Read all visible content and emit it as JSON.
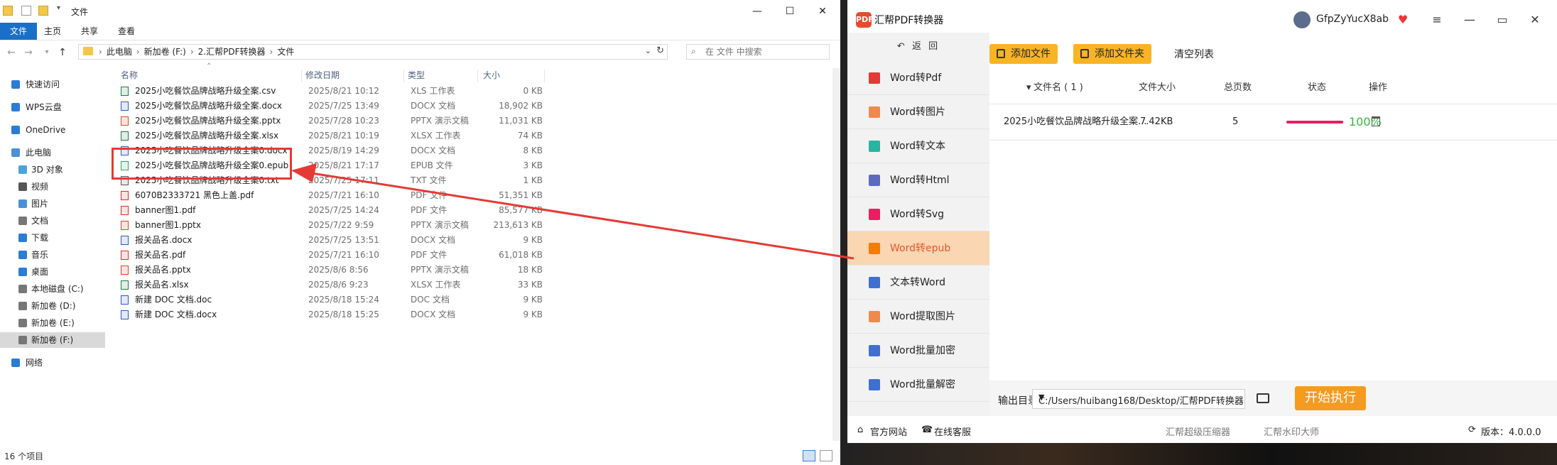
{
  "explorer": {
    "title": "文件",
    "ribbon_tabs": [
      "文件",
      "主页",
      "共享",
      "查看"
    ],
    "breadcrumbs": [
      "此电脑",
      "新加卷 (F:)",
      "2.汇帮PDF转换器",
      "文件"
    ],
    "search_placeholder": "在 文件 中搜索",
    "nav": [
      {
        "label": "快速访问",
        "icon": "star-icon",
        "color": "#2b7cd3"
      },
      {
        "label": "WPS云盘",
        "icon": "cloud-icon",
        "color": "#2b7cd3"
      },
      {
        "label": "OneDrive",
        "icon": "cloud-icon",
        "color": "#2b7cd3"
      },
      {
        "label": "此电脑",
        "icon": "computer-icon",
        "color": "#4a90d9"
      },
      {
        "label": "3D 对象",
        "icon": "cube-icon",
        "color": "#4aa3df"
      },
      {
        "label": "视频",
        "icon": "video-icon",
        "color": "#555555"
      },
      {
        "label": "图片",
        "icon": "picture-icon",
        "color": "#4a90d9"
      },
      {
        "label": "文档",
        "icon": "document-icon",
        "color": "#777777"
      },
      {
        "label": "下载",
        "icon": "download-icon",
        "color": "#2b7cd3"
      },
      {
        "label": "音乐",
        "icon": "music-icon",
        "color": "#2b7cd3"
      },
      {
        "label": "桌面",
        "icon": "desktop-icon",
        "color": "#2b7cd3"
      },
      {
        "label": "本地磁盘 (C:)",
        "icon": "drive-icon",
        "color": "#777777"
      },
      {
        "label": "新加卷 (D:)",
        "icon": "drive-icon",
        "color": "#777777"
      },
      {
        "label": "新加卷 (E:)",
        "icon": "drive-icon",
        "color": "#777777"
      },
      {
        "label": "新加卷 (F:)",
        "icon": "drive-icon",
        "color": "#777777"
      },
      {
        "label": "网络",
        "icon": "network-icon",
        "color": "#2b7cd3"
      }
    ],
    "columns": [
      "名称",
      "修改日期",
      "类型",
      "大小"
    ],
    "files": [
      {
        "name": "2025小吃餐饮品牌战略升级全案.csv",
        "date": "2025/8/21 10:12",
        "type": "XLS 工作表",
        "size": "0 KB",
        "color": "#1d7a45"
      },
      {
        "name": "2025小吃餐饮品牌战略升级全案.docx",
        "date": "2025/7/25 13:49",
        "type": "DOCX 文档",
        "size": "18,902 KB",
        "color": "#2b5cb8"
      },
      {
        "name": "2025小吃餐饮品牌战略升级全案.pptx",
        "date": "2025/7/28 10:23",
        "type": "PPTX 演示文稿",
        "size": "11,031 KB",
        "color": "#d24726"
      },
      {
        "name": "2025小吃餐饮品牌战略升级全案.xlsx",
        "date": "2025/8/21 10:19",
        "type": "XLSX 工作表",
        "size": "74 KB",
        "color": "#1d7a45"
      },
      {
        "name": "2025小吃餐饮品牌战略升级全案0.docx",
        "date": "2025/8/19 14:29",
        "type": "DOCX 文档",
        "size": "8 KB",
        "color": "#2b5cb8"
      },
      {
        "name": "2025小吃餐饮品牌战略升级全案0.epub",
        "date": "2025/8/21 17:17",
        "type": "EPUB 文件",
        "size": "3 KB",
        "color": "#3a9c6a"
      },
      {
        "name": "2025小吃餐饮品牌战略升级全案0.txt",
        "date": "2025/7/25 17:11",
        "type": "TXT 文件",
        "size": "1 KB",
        "color": "#555555"
      },
      {
        "name": "6070B2333721 黑色上盖.pdf",
        "date": "2025/7/21 16:10",
        "type": "PDF 文件",
        "size": "51,351 KB",
        "color": "#d93025"
      },
      {
        "name": "banner图1.pdf",
        "date": "2025/7/25 14:24",
        "type": "PDF 文件",
        "size": "85,577 KB",
        "color": "#d93025"
      },
      {
        "name": "banner图1.pptx",
        "date": "2025/7/22 9:59",
        "type": "PPTX 演示文稿",
        "size": "213,613 KB",
        "color": "#d24726"
      },
      {
        "name": "报关品名.docx",
        "date": "2025/7/25 13:51",
        "type": "DOCX 文档",
        "size": "9 KB",
        "color": "#2b5cb8"
      },
      {
        "name": "报关品名.pdf",
        "date": "2025/7/21 16:10",
        "type": "PDF 文件",
        "size": "61,018 KB",
        "color": "#d93025"
      },
      {
        "name": "报关品名.pptx",
        "date": "2025/8/6 8:56",
        "type": "PPTX 演示文稿",
        "size": "18 KB",
        "color": "#d24726"
      },
      {
        "name": "报关品名.xlsx",
        "date": "2025/8/6 9:23",
        "type": "XLSX 工作表",
        "size": "33 KB",
        "color": "#1d7a45"
      },
      {
        "name": "新建 DOC 文档.doc",
        "date": "2025/8/18 15:24",
        "type": "DOC 文档",
        "size": "9 KB",
        "color": "#2b5cb8"
      },
      {
        "name": "新建 DOC 文档.docx",
        "date": "2025/8/18 15:25",
        "type": "DOCX 文档",
        "size": "9 KB",
        "color": "#2b5cb8"
      }
    ],
    "status": "16 个项目"
  },
  "app": {
    "logo_text": "PDF",
    "title": "汇帮PDF转换器",
    "user": "GfpZyYucX8ab",
    "back_label": "返 回",
    "menu": [
      {
        "label": "Word转Pdf",
        "color": "#e53935"
      },
      {
        "label": "Word转图片",
        "color": "#f08a4b"
      },
      {
        "label": "Word转文本",
        "color": "#26b5a0"
      },
      {
        "label": "Word转Html",
        "color": "#5c6bc0"
      },
      {
        "label": "Word转Svg",
        "color": "#e91e63"
      },
      {
        "label": "Word转epub",
        "color": "#f57c00"
      },
      {
        "label": "文本转Word",
        "color": "#3f6fd1"
      },
      {
        "label": "Word提取图片",
        "color": "#f08a4b"
      },
      {
        "label": "Word批量加密",
        "color": "#3f6fd1"
      },
      {
        "label": "Word批量解密",
        "color": "#3f6fd1"
      }
    ],
    "active_index": 5,
    "add_file": "添加文件",
    "add_folder": "添加文件夹",
    "clear_list": "清空列表",
    "table_headers": [
      "文件名 ( 1 )",
      "文件大小",
      "总页数",
      "状态",
      "操作"
    ],
    "row": {
      "name": "2025小吃餐饮品牌战略升级全案...",
      "size": "7.42KB",
      "pages": "5",
      "progress": "100%"
    },
    "output_label": "输出目录:",
    "output_path": "C:/Users/huibang168/Desktop/汇帮PDF转换器",
    "start": "开始执行",
    "footer": {
      "site": "官方网站",
      "service": "在线客服",
      "compress": "汇帮超级压缩器",
      "watermark": "汇帮水印大师",
      "version": "版本：4.0.0.0"
    },
    "accent": "#f9b425"
  }
}
